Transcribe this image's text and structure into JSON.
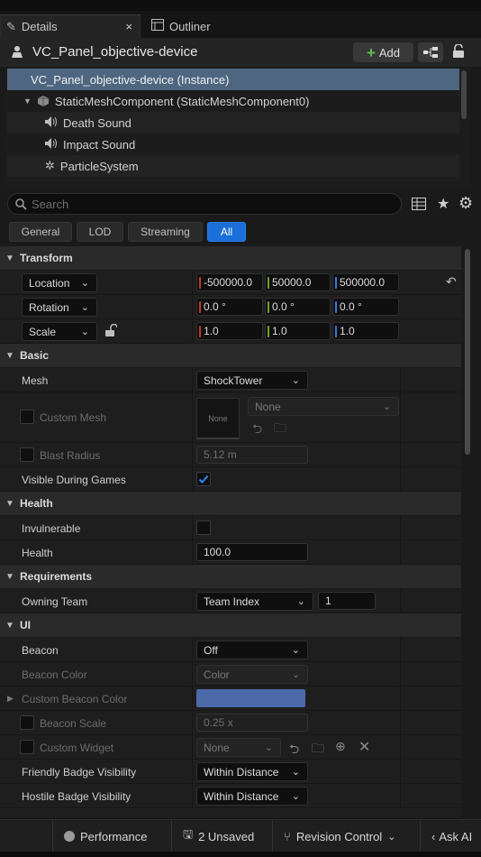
{
  "tabs": [
    {
      "label": "Details",
      "close": "×"
    },
    {
      "label": "Outliner"
    }
  ],
  "header": {
    "title": "VC_Panel_objective-device",
    "add_label": "Add"
  },
  "tree": [
    {
      "label": "VC_Panel_objective-device (Instance)",
      "icon": "actor-icon"
    },
    {
      "label": "StaticMeshComponent (StaticMeshComponent0)",
      "icon": "mesh-icon"
    },
    {
      "label": "Death Sound",
      "icon": "speaker-icon"
    },
    {
      "label": "Impact Sound",
      "icon": "speaker-icon"
    },
    {
      "label": "ParticleSystem",
      "icon": "particle-icon"
    }
  ],
  "search": {
    "placeholder": "Search"
  },
  "filters": [
    "General",
    "LOD",
    "Streaming",
    "All"
  ],
  "transform": {
    "title": "Transform",
    "location": {
      "label": "Location",
      "x": "-500000.0",
      "y": "50000.0",
      "z": "500000.0"
    },
    "rotation": {
      "label": "Rotation",
      "x": "0.0 °",
      "y": "0.0 °",
      "z": "0.0 °"
    },
    "scale": {
      "label": "Scale",
      "x": "1.0",
      "y": "1.0",
      "z": "1.0"
    }
  },
  "basic": {
    "title": "Basic",
    "mesh_label": "Mesh",
    "mesh_value": "ShockTower",
    "custom_mesh_label": "Custom Mesh",
    "custom_mesh_thumb": "None",
    "custom_mesh_value": "None",
    "blast_radius_label": "Blast Radius",
    "blast_radius_value": "5.12 m",
    "visible_label": "Visible During Games"
  },
  "health": {
    "title": "Health",
    "invulnerable_label": "Invulnerable",
    "health_label": "Health",
    "health_value": "100.0"
  },
  "requirements": {
    "title": "Requirements",
    "owning_team_label": "Owning Team",
    "owning_team_value": "Team Index",
    "owning_team_index": "1"
  },
  "ui": {
    "title": "UI",
    "beacon_label": "Beacon",
    "beacon_value": "Off",
    "beacon_color_label": "Beacon Color",
    "beacon_color_value": "Color",
    "custom_beacon_color_label": "Custom Beacon Color",
    "custom_beacon_color": "#4c6aa8",
    "beacon_scale_label": "Beacon Scale",
    "beacon_scale_value": "0.25 x",
    "custom_widget_label": "Custom Widget",
    "custom_widget_value": "None",
    "friendly_label": "Friendly Badge Visibility",
    "friendly_value": "Within Distance",
    "hostile_label": "Hostile Badge Visibility",
    "hostile_value": "Within Distance"
  },
  "statusbar": {
    "performance": "Performance",
    "unsaved": "2 Unsaved",
    "revision": "Revision Control",
    "askai": "Ask AI"
  },
  "colors": {
    "accent": "#1a6fd8",
    "selection": "#4e6680",
    "x_axis": "#c43b2b",
    "y_axis": "#6aa62b",
    "z_axis": "#3a7ad8"
  }
}
